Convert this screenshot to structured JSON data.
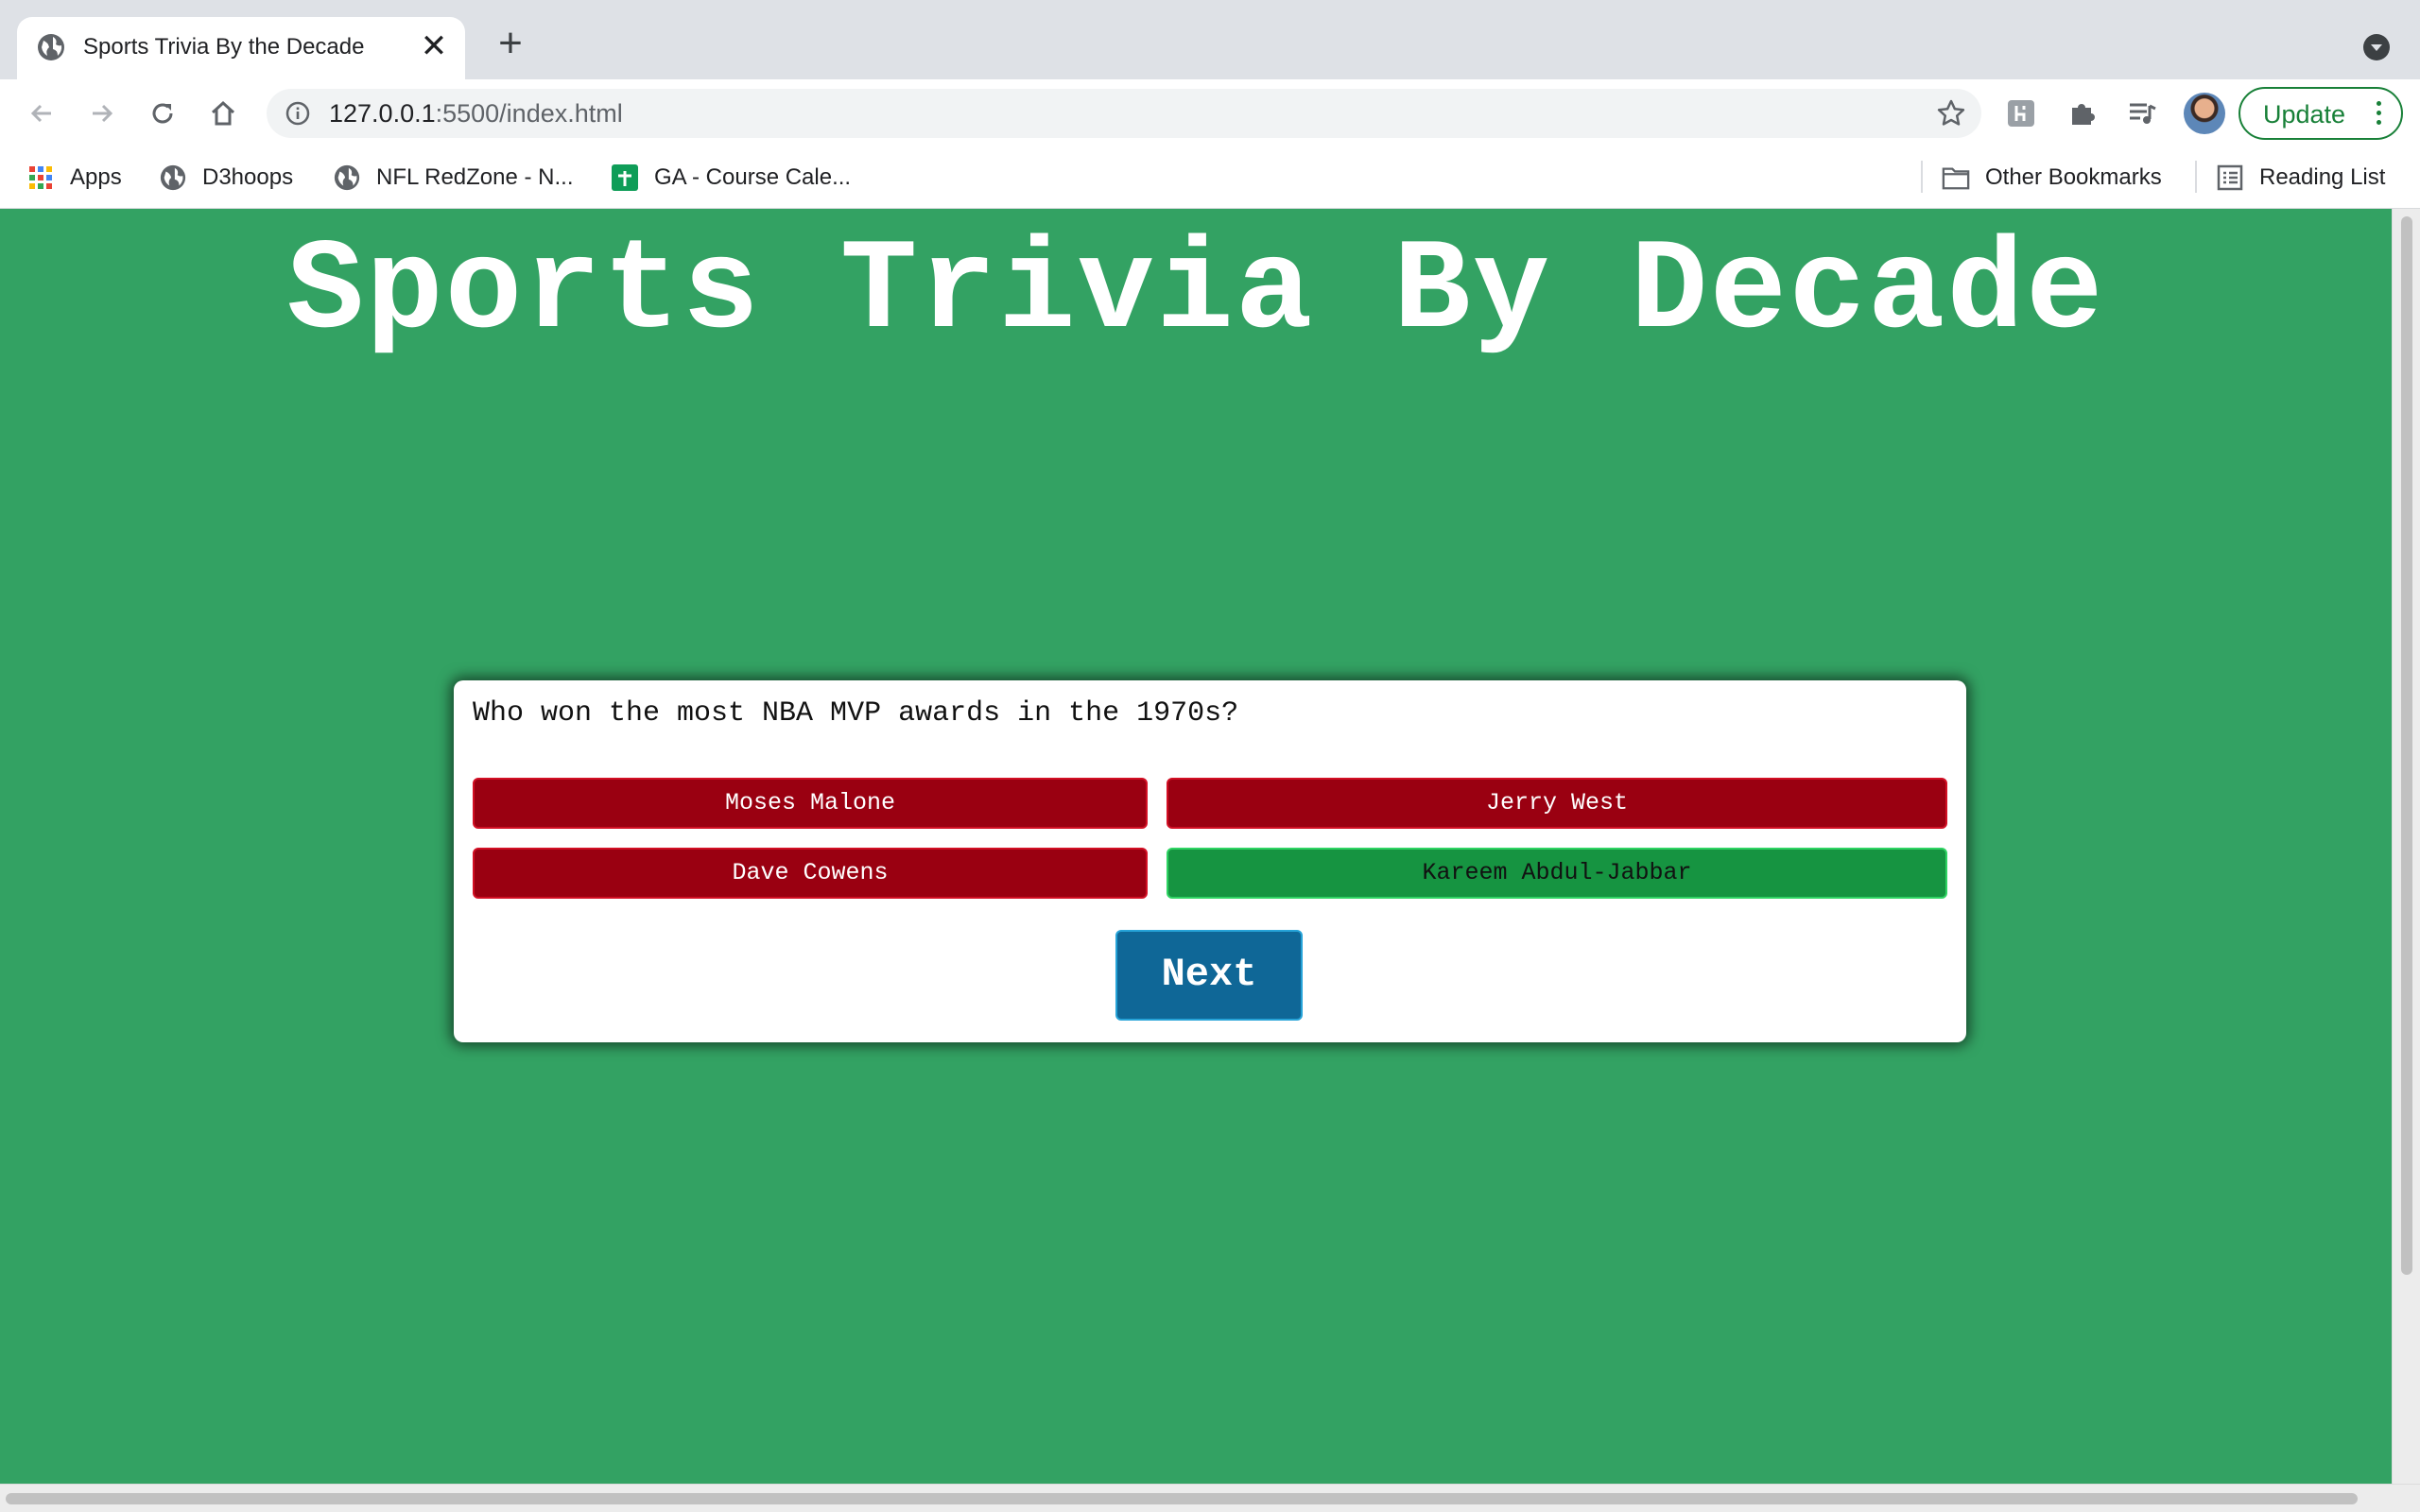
{
  "browser": {
    "tab_title": "Sports Trivia By the Decade",
    "tab_close_glyph": "✕",
    "new_tab_glyph": "+",
    "url_host": "127.0.0.1",
    "url_rest": ":5500/index.html",
    "update_label": "Update",
    "update_color": "#188038",
    "bookmarks": [
      {
        "label": "Apps",
        "icon": "apps-grid-icon"
      },
      {
        "label": "D3hoops",
        "icon": "globe-icon"
      },
      {
        "label": "NFL RedZone - N...",
        "icon": "globe-icon"
      },
      {
        "label": "GA - Course Cale...",
        "icon": "sheets-icon"
      }
    ],
    "other_bookmarks": "Other Bookmarks",
    "reading_list": "Reading List"
  },
  "page": {
    "background": "#33a263",
    "title": "Sports Trivia By Decade",
    "question": "Who won the most NBA MVP awards in the 1970s?",
    "answers": [
      {
        "label": "Moses Malone",
        "state": "wrong"
      },
      {
        "label": "Jerry West",
        "state": "wrong"
      },
      {
        "label": "Dave Cowens",
        "state": "wrong"
      },
      {
        "label": "Kareem Abdul-Jabbar",
        "state": "correct"
      }
    ],
    "next_label": "Next",
    "colors": {
      "wrong": "#9a0011",
      "correct": "#169441",
      "next": "#0f6797"
    }
  }
}
